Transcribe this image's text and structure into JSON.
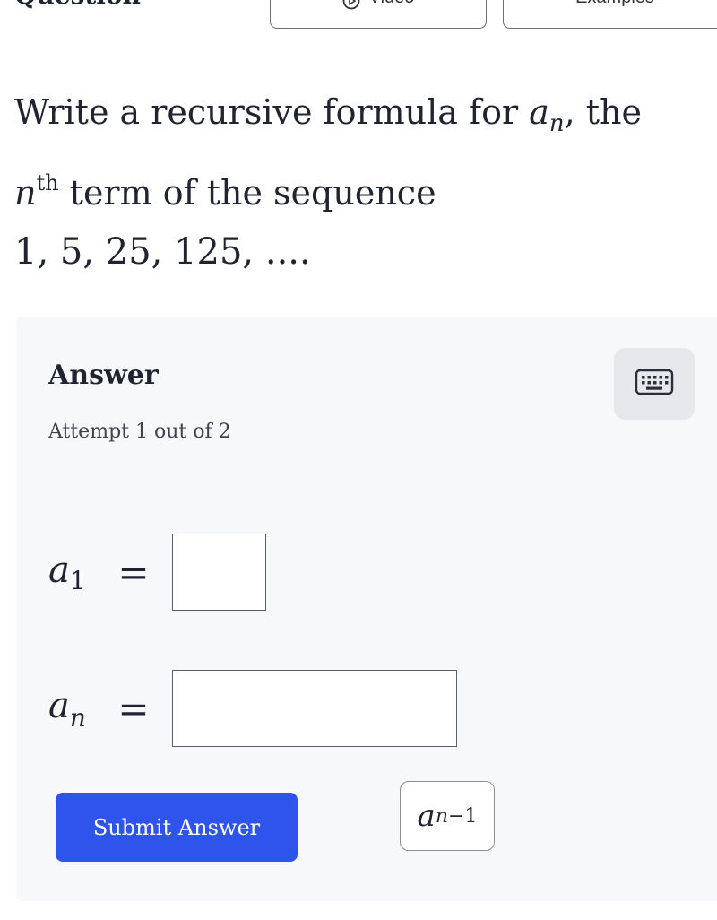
{
  "header": {
    "question_label": "Question",
    "tabs": {
      "video": "Video",
      "examples": "Examples"
    }
  },
  "question": {
    "line1_prefix": "Write a recursive formula for ",
    "var_a": "a",
    "var_n": "n",
    "line1_suffix": ", the",
    "sup_th": "th",
    "line2_suffix": " term of the sequence",
    "sequence": "1, 5, 25, 125, ...."
  },
  "answer": {
    "title": "Answer",
    "attempt": "Attempt 1 out of 2",
    "eq1": {
      "var": "a",
      "sub": "1",
      "sign": "="
    },
    "eq2": {
      "var": "a",
      "sub": "n",
      "sign": "="
    },
    "submit_label": "Submit Answer",
    "chip": {
      "var": "a",
      "sub_n": "n",
      "sub_rest": "−1"
    }
  }
}
